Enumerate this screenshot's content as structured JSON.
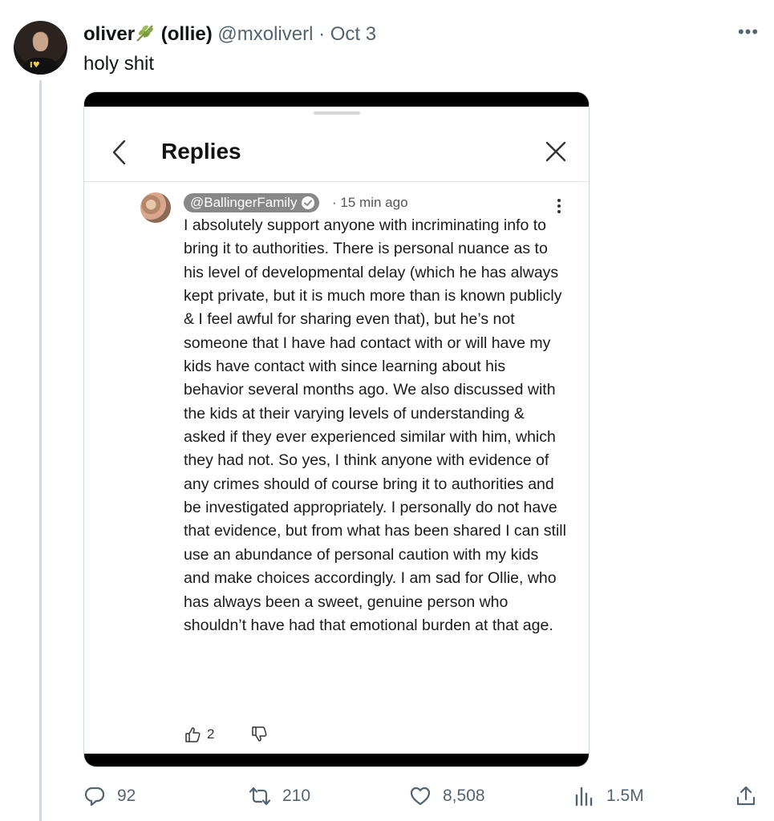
{
  "tweet": {
    "display_name": "oliver",
    "display_name_suffix": "(ollie)",
    "handle": "@mxoliverl",
    "separator": "·",
    "date": "Oct 3",
    "text": "holy shit",
    "more_label": "•••"
  },
  "screenshot": {
    "title": "Replies",
    "reply": {
      "username": "@BallingerFamily",
      "separator": "·",
      "time": "15 min ago",
      "body": "I absolutely support anyone with incriminating info to bring it to authorities. There is personal nuance as to his level of developmental delay (which he has always kept private, but it is much more than is known publicly & I feel awful for sharing even that), but he’s not someone that I have had contact with or will have my kids have contact with since learning about his behavior several months ago. We also discussed with the kids at their varying levels of understanding & asked if they ever experienced similar with him, which they had not. So yes, I think anyone with evidence of any crimes should of course bring it to authorities and be investigated appropriately. I personally do not have that evidence, but from what has been shared I can still use an abundance of personal caution with my kids and make choices accordingly. I am sad for Ollie, who has always been a sweet, genuine person who shouldn’t have had that emotional burden at that age.",
      "likes": "2"
    }
  },
  "actions": {
    "replies": "92",
    "reposts": "210",
    "likes": "8,508",
    "views": "1.5M"
  },
  "colors": {
    "text_primary": "#0f1419",
    "text_secondary": "#536471",
    "thread_line": "#cfd9de"
  },
  "icons": [
    "leaf-icon",
    "more-icon",
    "back-chevron-icon",
    "close-icon",
    "verified-check-icon",
    "kebab-menu-icon",
    "thumbs-up-icon",
    "thumbs-down-icon",
    "reply-icon",
    "repost-icon",
    "heart-icon",
    "views-icon",
    "share-icon"
  ]
}
